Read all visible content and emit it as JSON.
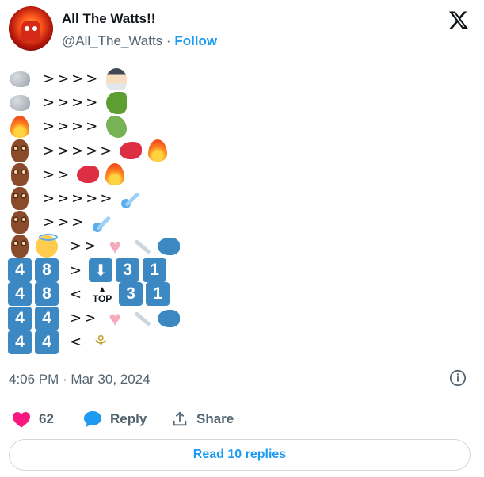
{
  "author": {
    "name": "All The Watts!!",
    "handle": "@All_The_Watts",
    "separator": "·",
    "follow_label": "Follow"
  },
  "rows": [
    {
      "tokens": [
        {
          "t": "emoji",
          "icon": "rock-icon"
        },
        {
          "t": "text",
          "v": ">>>>"
        },
        {
          "t": "emoji",
          "icon": "person-icon"
        }
      ]
    },
    {
      "tokens": [
        {
          "t": "emoji",
          "icon": "rock-icon"
        },
        {
          "t": "text",
          "v": ">>>>"
        },
        {
          "t": "emoji",
          "icon": "dinosaur-icon"
        }
      ]
    },
    {
      "tokens": [
        {
          "t": "emoji",
          "icon": "fire-icon"
        },
        {
          "t": "text",
          "v": ">>>>"
        },
        {
          "t": "emoji",
          "icon": "dragon-icon"
        }
      ]
    },
    {
      "tokens": [
        {
          "t": "emoji",
          "icon": "owl-icon"
        },
        {
          "t": "text",
          "v": ">>>>>"
        },
        {
          "t": "emoji",
          "icon": "bird-icon"
        },
        {
          "t": "emoji",
          "icon": "fire-icon"
        }
      ]
    },
    {
      "tokens": [
        {
          "t": "emoji",
          "icon": "owl-icon"
        },
        {
          "t": "text",
          "v": ">>"
        },
        {
          "t": "emoji",
          "icon": "bird-icon"
        },
        {
          "t": "emoji",
          "icon": "fire-icon"
        }
      ]
    },
    {
      "tokens": [
        {
          "t": "emoji",
          "icon": "owl-icon"
        },
        {
          "t": "text",
          "v": ">>>>>"
        },
        {
          "t": "emoji",
          "icon": "comet-icon"
        }
      ]
    },
    {
      "tokens": [
        {
          "t": "emoji",
          "icon": "owl-icon"
        },
        {
          "t": "text",
          "v": ">>>"
        },
        {
          "t": "emoji",
          "icon": "comet-icon"
        }
      ]
    },
    {
      "tokens": [
        {
          "t": "emoji",
          "icon": "owl-icon"
        },
        {
          "t": "emoji",
          "icon": "halo-face-icon"
        },
        {
          "t": "text",
          "v": ">>"
        },
        {
          "t": "emoji",
          "icon": "heart-icon"
        },
        {
          "t": "emoji",
          "icon": "bone-icon"
        },
        {
          "t": "emoji",
          "icon": "fish-icon"
        }
      ]
    },
    {
      "tokens": [
        {
          "t": "key",
          "v": "4"
        },
        {
          "t": "key",
          "v": "8"
        },
        {
          "t": "text",
          "v": ">"
        },
        {
          "t": "emoji",
          "icon": "down-arrow-icon"
        },
        {
          "t": "key",
          "v": "3"
        },
        {
          "t": "key",
          "v": "1"
        }
      ]
    },
    {
      "tokens": [
        {
          "t": "key",
          "v": "4"
        },
        {
          "t": "key",
          "v": "8"
        },
        {
          "t": "text",
          "v": "<"
        },
        {
          "t": "top",
          "v": "TOP"
        },
        {
          "t": "key",
          "v": "3"
        },
        {
          "t": "key",
          "v": "1"
        }
      ]
    },
    {
      "tokens": [
        {
          "t": "key",
          "v": "4"
        },
        {
          "t": "key",
          "v": "4"
        },
        {
          "t": "text",
          "v": ">>"
        },
        {
          "t": "emoji",
          "icon": "heart-icon"
        },
        {
          "t": "emoji",
          "icon": "bone-icon"
        },
        {
          "t": "emoji",
          "icon": "fish-icon"
        }
      ]
    },
    {
      "tokens": [
        {
          "t": "key",
          "v": "4"
        },
        {
          "t": "key",
          "v": "4"
        },
        {
          "t": "text",
          "v": "<"
        },
        {
          "t": "emoji",
          "icon": "rice-ear-icon"
        }
      ]
    }
  ],
  "timestamp": "4:06 PM · Mar 30, 2024",
  "actions": {
    "likes": "62",
    "reply": "Reply",
    "share": "Share"
  },
  "read_replies": "Read 10 replies",
  "colors": {
    "accent": "#1d9bf0",
    "like": "#f91880",
    "keycap": "#3b88c3"
  }
}
